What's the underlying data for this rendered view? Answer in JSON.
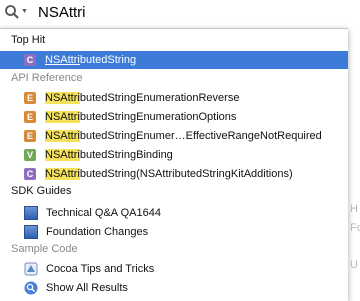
{
  "search": {
    "query": "NSAttri"
  },
  "top_hit": {
    "header": "Top Hit",
    "items": [
      {
        "badge": "C",
        "match": "NSAttri",
        "rest": "butedString"
      }
    ]
  },
  "api_reference": {
    "header": "API Reference",
    "items": [
      {
        "badge": "E",
        "match": "NSAttri",
        "rest": "butedStringEnumerationReverse"
      },
      {
        "badge": "E",
        "match": "NSAttri",
        "rest": "butedStringEnumerationOptions"
      },
      {
        "badge": "E",
        "match": "NSAttri",
        "rest": "butedStringEnumer…EffectiveRangeNotRequired"
      },
      {
        "badge": "V",
        "match": "NSAttri",
        "rest": "butedStringBinding"
      },
      {
        "badge": "C",
        "match": "NSAttri",
        "rest": "butedString(NSAttributedStringKitAdditions)"
      }
    ]
  },
  "sdk_guides": {
    "header": "SDK Guides",
    "items": [
      {
        "label": "Technical Q&A QA1644",
        "edge": "H"
      },
      {
        "label": "Foundation Changes",
        "edge": "Fo"
      }
    ]
  },
  "sample_code": {
    "header": "Sample Code",
    "items": [
      {
        "label": "Cocoa Tips and Tricks",
        "edge": "U"
      }
    ]
  },
  "footer": {
    "show_all": "Show All Results"
  },
  "colors": {
    "selection": "#3d7bd9",
    "highlight": "#f5e15a",
    "class_badge": "#8d6fc2",
    "enum_badge": "#d88a3a",
    "var_badge": "#73a85a"
  }
}
